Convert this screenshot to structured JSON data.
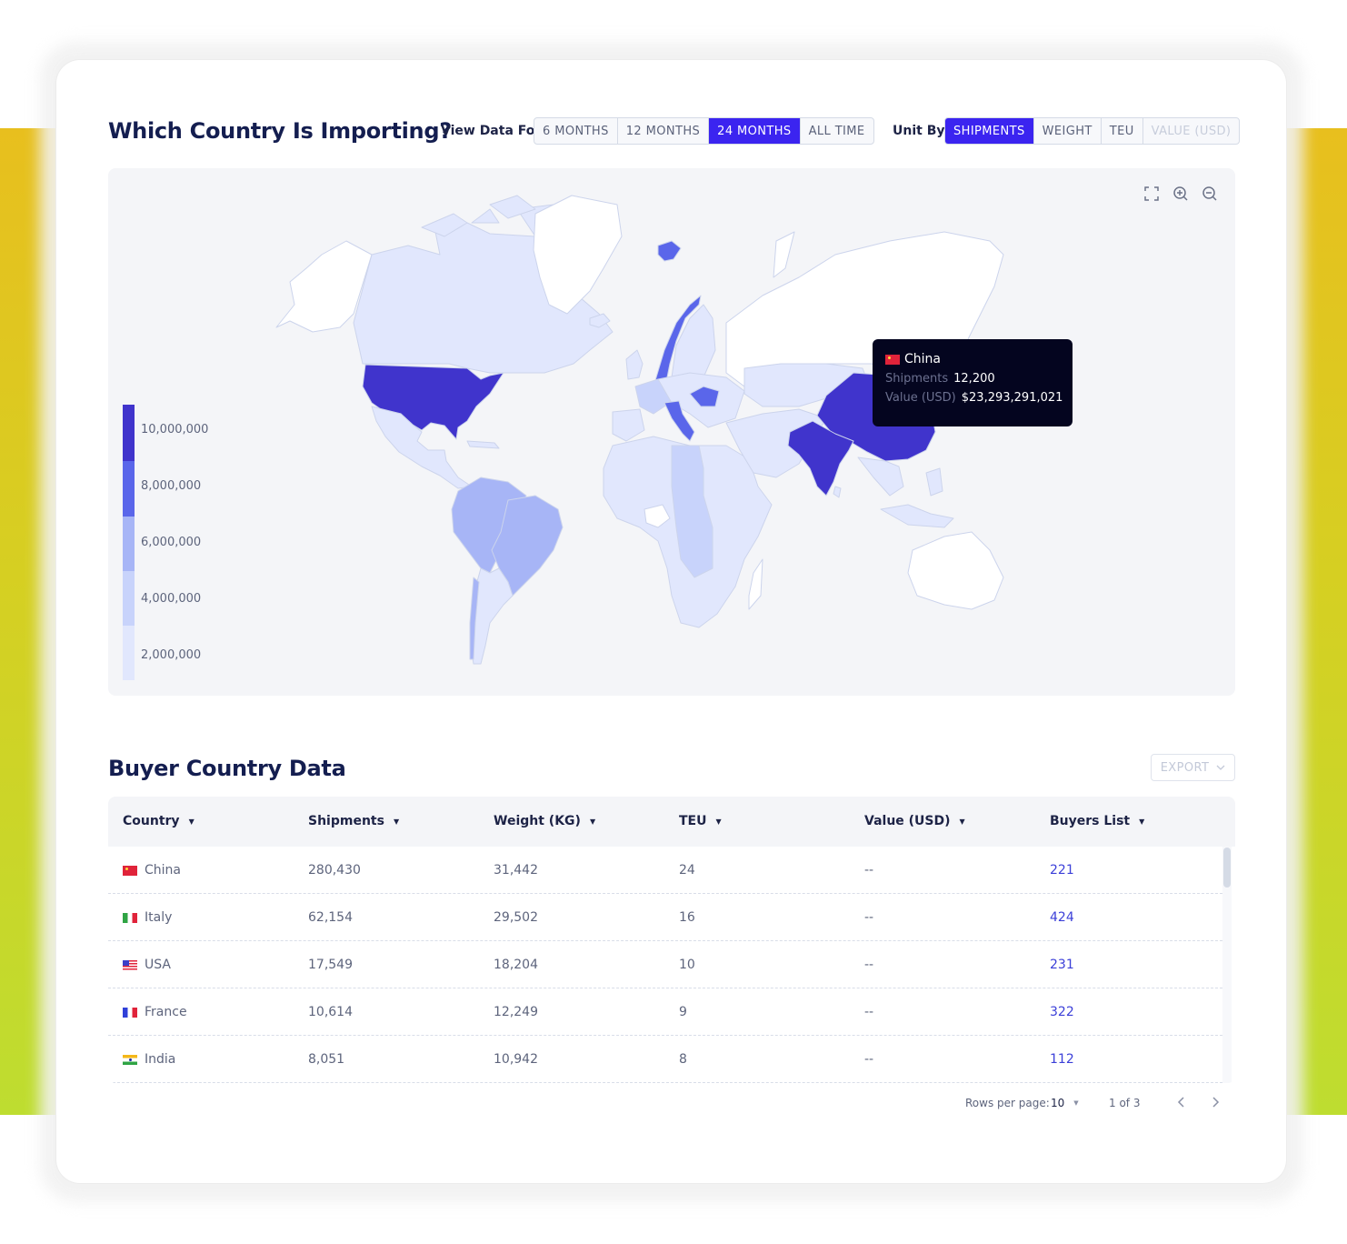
{
  "header": {
    "title": "Which Country Is Importing?",
    "view_label": "View Data For",
    "view_options": [
      {
        "label": "6 MONTHS",
        "active": false
      },
      {
        "label": "12 MONTHS",
        "active": false
      },
      {
        "label": "24 MONTHS",
        "active": true
      },
      {
        "label": "ALL TIME",
        "active": false
      }
    ],
    "unit_label": "Unit By",
    "unit_options": [
      {
        "label": "SHIPMENTS",
        "active": true
      },
      {
        "label": "WEIGHT",
        "active": false
      },
      {
        "label": "TEU",
        "active": false
      },
      {
        "label": "VALUE (USD)",
        "active": false,
        "disabled": true
      }
    ]
  },
  "map": {
    "tools": [
      "fullscreen-icon",
      "zoom-in-icon",
      "zoom-out-icon"
    ],
    "legend": [
      {
        "label": "10,000,000",
        "color": "#4034cc"
      },
      {
        "label": "8,000,000",
        "color": "#5a66ea"
      },
      {
        "label": "6,000,000",
        "color": "#a7b5f6"
      },
      {
        "label": "4,000,000",
        "color": "#c8d3fb"
      },
      {
        "label": "2,000,000",
        "color": "#e1e7fd"
      }
    ],
    "colors": {
      "background": "#f4f5f8",
      "no_data": "#ffffff",
      "border": "#ccd4ec"
    },
    "tooltip": {
      "country": "China",
      "flag": "cn",
      "rows": [
        {
          "key": "Shipments",
          "value": "12,200"
        },
        {
          "key": "Value (USD)",
          "value": "$23,293,291,021"
        }
      ]
    }
  },
  "table": {
    "title": "Buyer Country Data",
    "export_label": "EXPORT",
    "columns": [
      "Country",
      "Shipments",
      "Weight (KG)",
      "TEU",
      "Value (USD)",
      "Buyers List"
    ],
    "rows": [
      {
        "flag": "cn",
        "country": "China",
        "shipments": "280,430",
        "weight": "31,442",
        "teu": "24",
        "value": "--",
        "buyers": "221"
      },
      {
        "flag": "it",
        "country": "Italy",
        "shipments": "62,154",
        "weight": "29,502",
        "teu": "16",
        "value": "--",
        "buyers": "424"
      },
      {
        "flag": "us",
        "country": "USA",
        "shipments": "17,549",
        "weight": "18,204",
        "teu": "10",
        "value": "--",
        "buyers": "231"
      },
      {
        "flag": "fr",
        "country": "France",
        "shipments": "10,614",
        "weight": "12,249",
        "teu": "9",
        "value": "--",
        "buyers": "322"
      },
      {
        "flag": "in",
        "country": "India",
        "shipments": "8,051",
        "weight": "10,942",
        "teu": "8",
        "value": "--",
        "buyers": "112"
      }
    ],
    "pagination": {
      "rows_per_page_label": "Rows per page:",
      "rows_per_page": "10",
      "page_info": "1 of 3"
    }
  },
  "theme": {
    "accent": "#3b24f0",
    "link": "#3b3fd8",
    "heading": "#141e50",
    "tooltip_bg": "#04051f"
  }
}
